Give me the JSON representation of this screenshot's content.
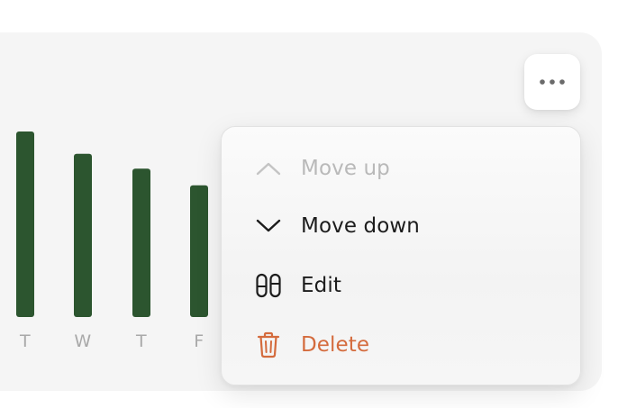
{
  "chart_data": {
    "type": "bar",
    "categories": [
      "T",
      "W",
      "T",
      "F"
    ],
    "values": [
      100,
      88,
      80,
      71
    ],
    "color": "#2c552f"
  },
  "more_button": {
    "icon": "more-horizontal-icon",
    "dots": "•••"
  },
  "menu": {
    "items": [
      {
        "label": "Move up",
        "icon": "chevron-up-icon",
        "state": "disabled"
      },
      {
        "label": "Move down",
        "icon": "chevron-down-icon",
        "state": "normal"
      },
      {
        "label": "Edit",
        "icon": "edit-pills-icon",
        "state": "normal"
      },
      {
        "label": "Delete",
        "icon": "trash-icon",
        "state": "danger"
      }
    ]
  },
  "colors": {
    "bar": "#2c552f",
    "danger": "#d46b3d",
    "disabled": "#b9b9b9",
    "text": "#1c1c1c",
    "card_bg": "#f5f5f5"
  }
}
